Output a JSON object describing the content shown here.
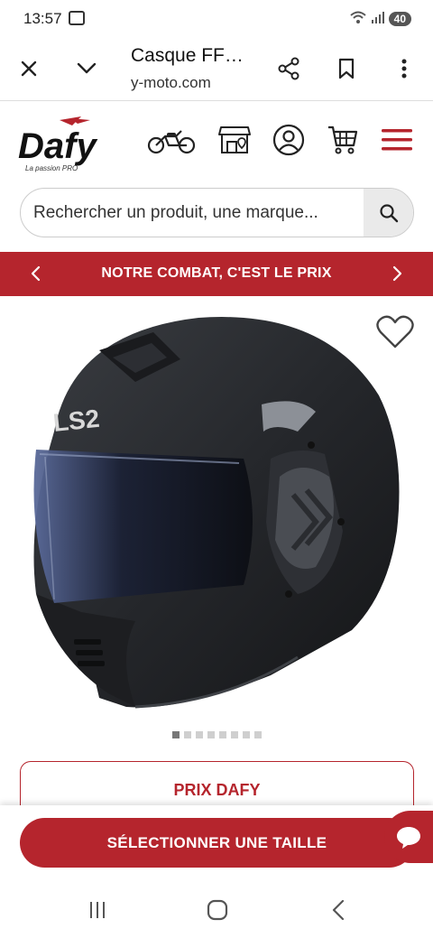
{
  "status": {
    "time": "13:57",
    "battery": "40",
    "icons": [
      "screencast-icon",
      "wifi-icon",
      "signal-icon",
      "battery-icon"
    ]
  },
  "browser": {
    "title": "Casque FF…",
    "url": "y-moto.com",
    "icons": [
      "close-icon",
      "chevron-down-icon",
      "share-icon",
      "bookmark-icon",
      "more-vert-icon"
    ]
  },
  "site": {
    "logo_text": "Dafy",
    "logo_tagline": "La passion PRO",
    "header_icons": [
      "motorcycle-icon",
      "store-icon",
      "account-icon",
      "cart-icon",
      "menu-icon"
    ],
    "brand_color": "#b5252d"
  },
  "search": {
    "placeholder": "Rechercher un produit, une marque..."
  },
  "banner": {
    "text": "NOTRE COMBAT, C'EST LE PRIX"
  },
  "product": {
    "image_subject": "motorcycle-helmet",
    "helmet_brand_mark": "LS2",
    "carousel_total": 8,
    "carousel_active": 1
  },
  "price": {
    "label": "PRIX DAFY"
  },
  "cta": {
    "select_size": "SÉLECTIONNER UNE TAILLE"
  }
}
